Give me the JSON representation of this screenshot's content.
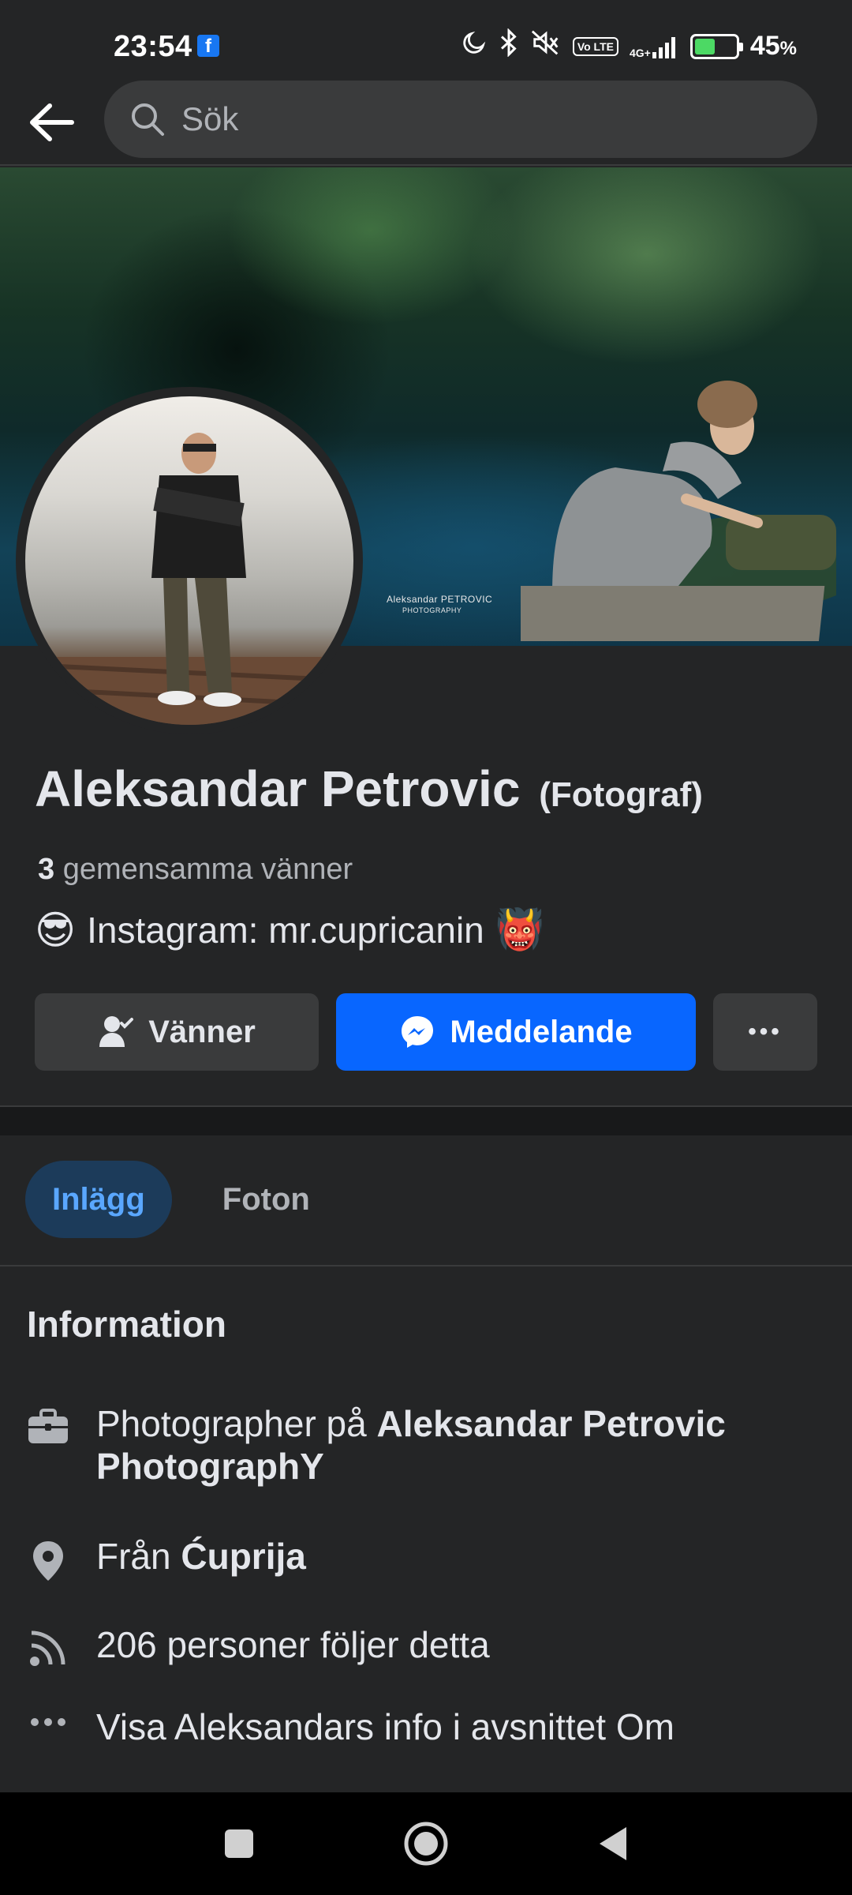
{
  "status_bar": {
    "time": "23:54",
    "network": "4G+",
    "volte": "Vo LTE",
    "battery_pct": "45",
    "battery_unit": "%",
    "battery_level": 0.45,
    "icons": [
      "facebook-notification-icon",
      "moon-icon",
      "bluetooth-icon",
      "mute-icon",
      "volte-icon",
      "signal-icon",
      "battery-charging-icon"
    ]
  },
  "header": {
    "search_placeholder": "Sök"
  },
  "cover": {
    "watermark_name": "Aleksandar PETROVIC",
    "watermark_sub": "PHOTOGRAPHY"
  },
  "profile": {
    "name": "Aleksandar Petrovic",
    "name_suffix": "(Fotograf)",
    "mutual_count": "3",
    "mutual_label": "gemensamma vänner",
    "bio_emoji_left": "😎",
    "bio_text": "Instagram: mr.cupricanin",
    "bio_emoji_right": "👹"
  },
  "actions": {
    "friends_label": "Vänner",
    "message_label": "Meddelande",
    "more_label": "•••"
  },
  "tabs": [
    {
      "label": "Inlägg",
      "active": true
    },
    {
      "label": "Foton",
      "active": false
    }
  ],
  "info": {
    "title": "Information",
    "work_prefix": "Photographer på ",
    "work_place": "Aleksandar Petrovic PhotographY",
    "from_prefix": "Från ",
    "from_place": "Ćuprija",
    "followers": "206 personer följer detta",
    "see_more": "Visa Aleksandars info i avsnittet Om"
  },
  "colors": {
    "background": "#242526",
    "primary_button": "#0866ff",
    "active_tab_bg": "#1c3b5a",
    "active_tab_text": "#5aa7ff",
    "secondary_text": "#b0b3b8"
  }
}
